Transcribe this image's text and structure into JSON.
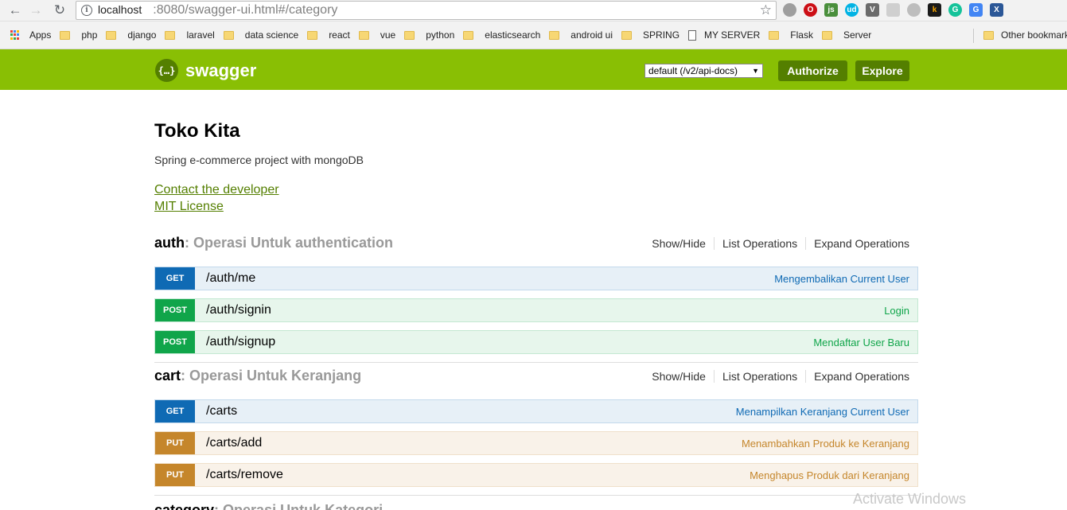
{
  "browser": {
    "url_host": "localhost",
    "url_path": ":8080/swagger-ui.html#/category",
    "bookmarks": [
      "Apps",
      "php",
      "django",
      "laravel",
      "data science",
      "react",
      "vue",
      "python",
      "elasticsearch",
      "android ui",
      "SPRING",
      "MY SERVER",
      "Flask",
      "Server"
    ],
    "other_bookmarks": "Other bookmarks",
    "extensions": [
      {
        "label": "",
        "color": "#9e9e9e"
      },
      {
        "label": "O",
        "color": "#cc0f16"
      },
      {
        "label": "js",
        "color": "#4a8f3c"
      },
      {
        "label": "ud",
        "color": "#02b3e4"
      },
      {
        "label": "V",
        "color": "#6b6b6b"
      },
      {
        "label": "",
        "color": "#cfcfcf"
      },
      {
        "label": "",
        "color": "#bdbdbd"
      },
      {
        "label": "k",
        "color": "#1a1a1a"
      },
      {
        "label": "G",
        "color": "#15c39a"
      },
      {
        "label": "G",
        "color": "#4285f4"
      },
      {
        "label": "X",
        "color": "#2b5797"
      }
    ]
  },
  "header": {
    "logo_text": "swagger",
    "logo_glyph": "{…}",
    "spec_select": "default (/v2/api-docs)",
    "authorize": "Authorize",
    "explore": "Explore"
  },
  "info": {
    "title": "Toko Kita",
    "description": "Spring e-commerce project with mongoDB",
    "contact": "Contact the developer",
    "license": "MIT License"
  },
  "resources": [
    {
      "name": "auth",
      "desc": ": Operasi Untuk authentication",
      "actions": [
        "Show/Hide",
        "List Operations",
        "Expand Operations"
      ],
      "operations": [
        {
          "verb": "GET",
          "path": "/auth/me",
          "summary": "Mengembalikan Current User"
        },
        {
          "verb": "POST",
          "path": "/auth/signin",
          "summary": "Login"
        },
        {
          "verb": "POST",
          "path": "/auth/signup",
          "summary": "Mendaftar User Baru"
        }
      ]
    },
    {
      "name": "cart",
      "desc": ": Operasi Untuk Keranjang",
      "actions": [
        "Show/Hide",
        "List Operations",
        "Expand Operations"
      ],
      "operations": [
        {
          "verb": "GET",
          "path": "/carts",
          "summary": "Menampilkan Keranjang Current User"
        },
        {
          "verb": "PUT",
          "path": "/carts/add",
          "summary": "Menambahkan Produk ke Keranjang"
        },
        {
          "verb": "PUT",
          "path": "/carts/remove",
          "summary": "Menghapus Produk dari Keranjang"
        }
      ]
    },
    {
      "name": "category",
      "desc": ": Operasi Untuk Kategori"
    }
  ],
  "watermark": "Activate Windows"
}
